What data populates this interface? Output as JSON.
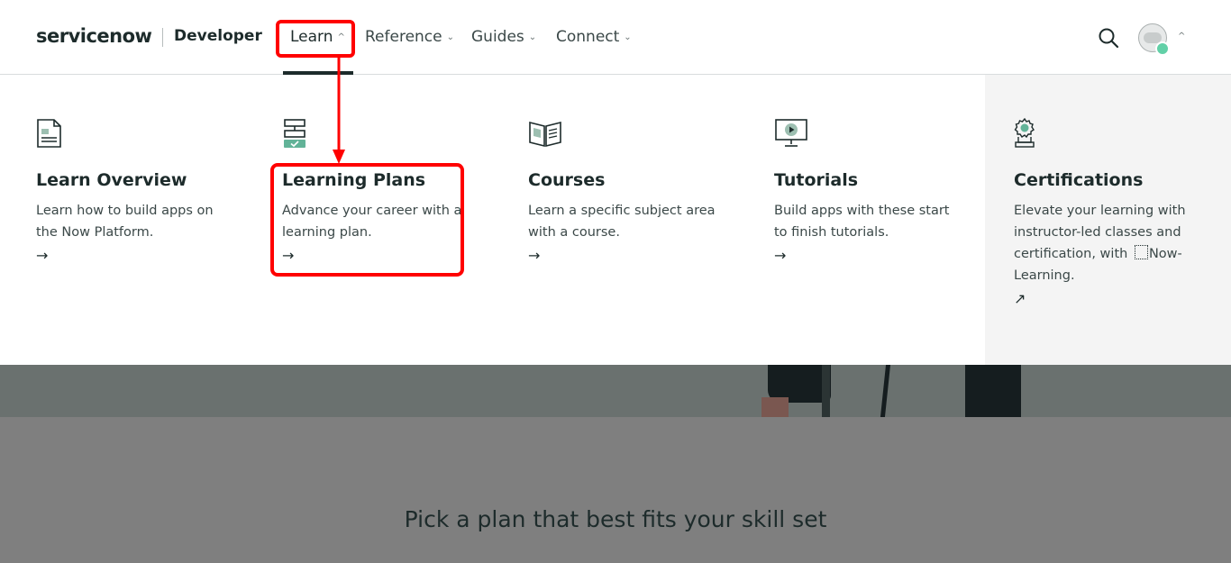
{
  "brand": {
    "logo": "servicenow",
    "subtitle": "Developer"
  },
  "nav": [
    {
      "label": "Learn",
      "chevron": "^"
    },
    {
      "label": "Reference",
      "chevron": "⌄"
    },
    {
      "label": "Guides",
      "chevron": "⌄"
    },
    {
      "label": "Connect",
      "chevron": "⌄"
    }
  ],
  "header_icons": {
    "search": "search-icon",
    "avatar": "user-avatar",
    "avatar_chevron": "^"
  },
  "menu": {
    "items": [
      {
        "title": "Learn Overview",
        "desc1": "Learn how to build apps on",
        "desc2": "the Now Platform.",
        "arrow": "→",
        "icon": "document-icon"
      },
      {
        "title": "Learning Plans",
        "desc1": "Advance your career with a",
        "desc2": "learning plan.",
        "arrow": "→",
        "icon": "plan-icon"
      },
      {
        "title": "Courses",
        "desc1": "Learn a specific subject area",
        "desc2": "with a course.",
        "arrow": "→",
        "icon": "book-icon"
      },
      {
        "title": "Tutorials",
        "desc1": "Build apps with these start",
        "desc2": "to finish tutorials.",
        "arrow": "→",
        "icon": "monitor-play-icon"
      }
    ],
    "certifications": {
      "title": "Certifications",
      "desc1": "Elevate your learning with",
      "desc2": "instructor-led classes and",
      "desc3": "certification, with",
      "desc3b": "Now-",
      "desc4": "Learning.",
      "arrow": "↗",
      "icon": "award-icon"
    }
  },
  "page": {
    "heading": "Pick a plan that best fits your skill set"
  },
  "colors": {
    "highlight": "#ff0000",
    "accent": "#62d0a7",
    "text": "#1d2b2b"
  }
}
